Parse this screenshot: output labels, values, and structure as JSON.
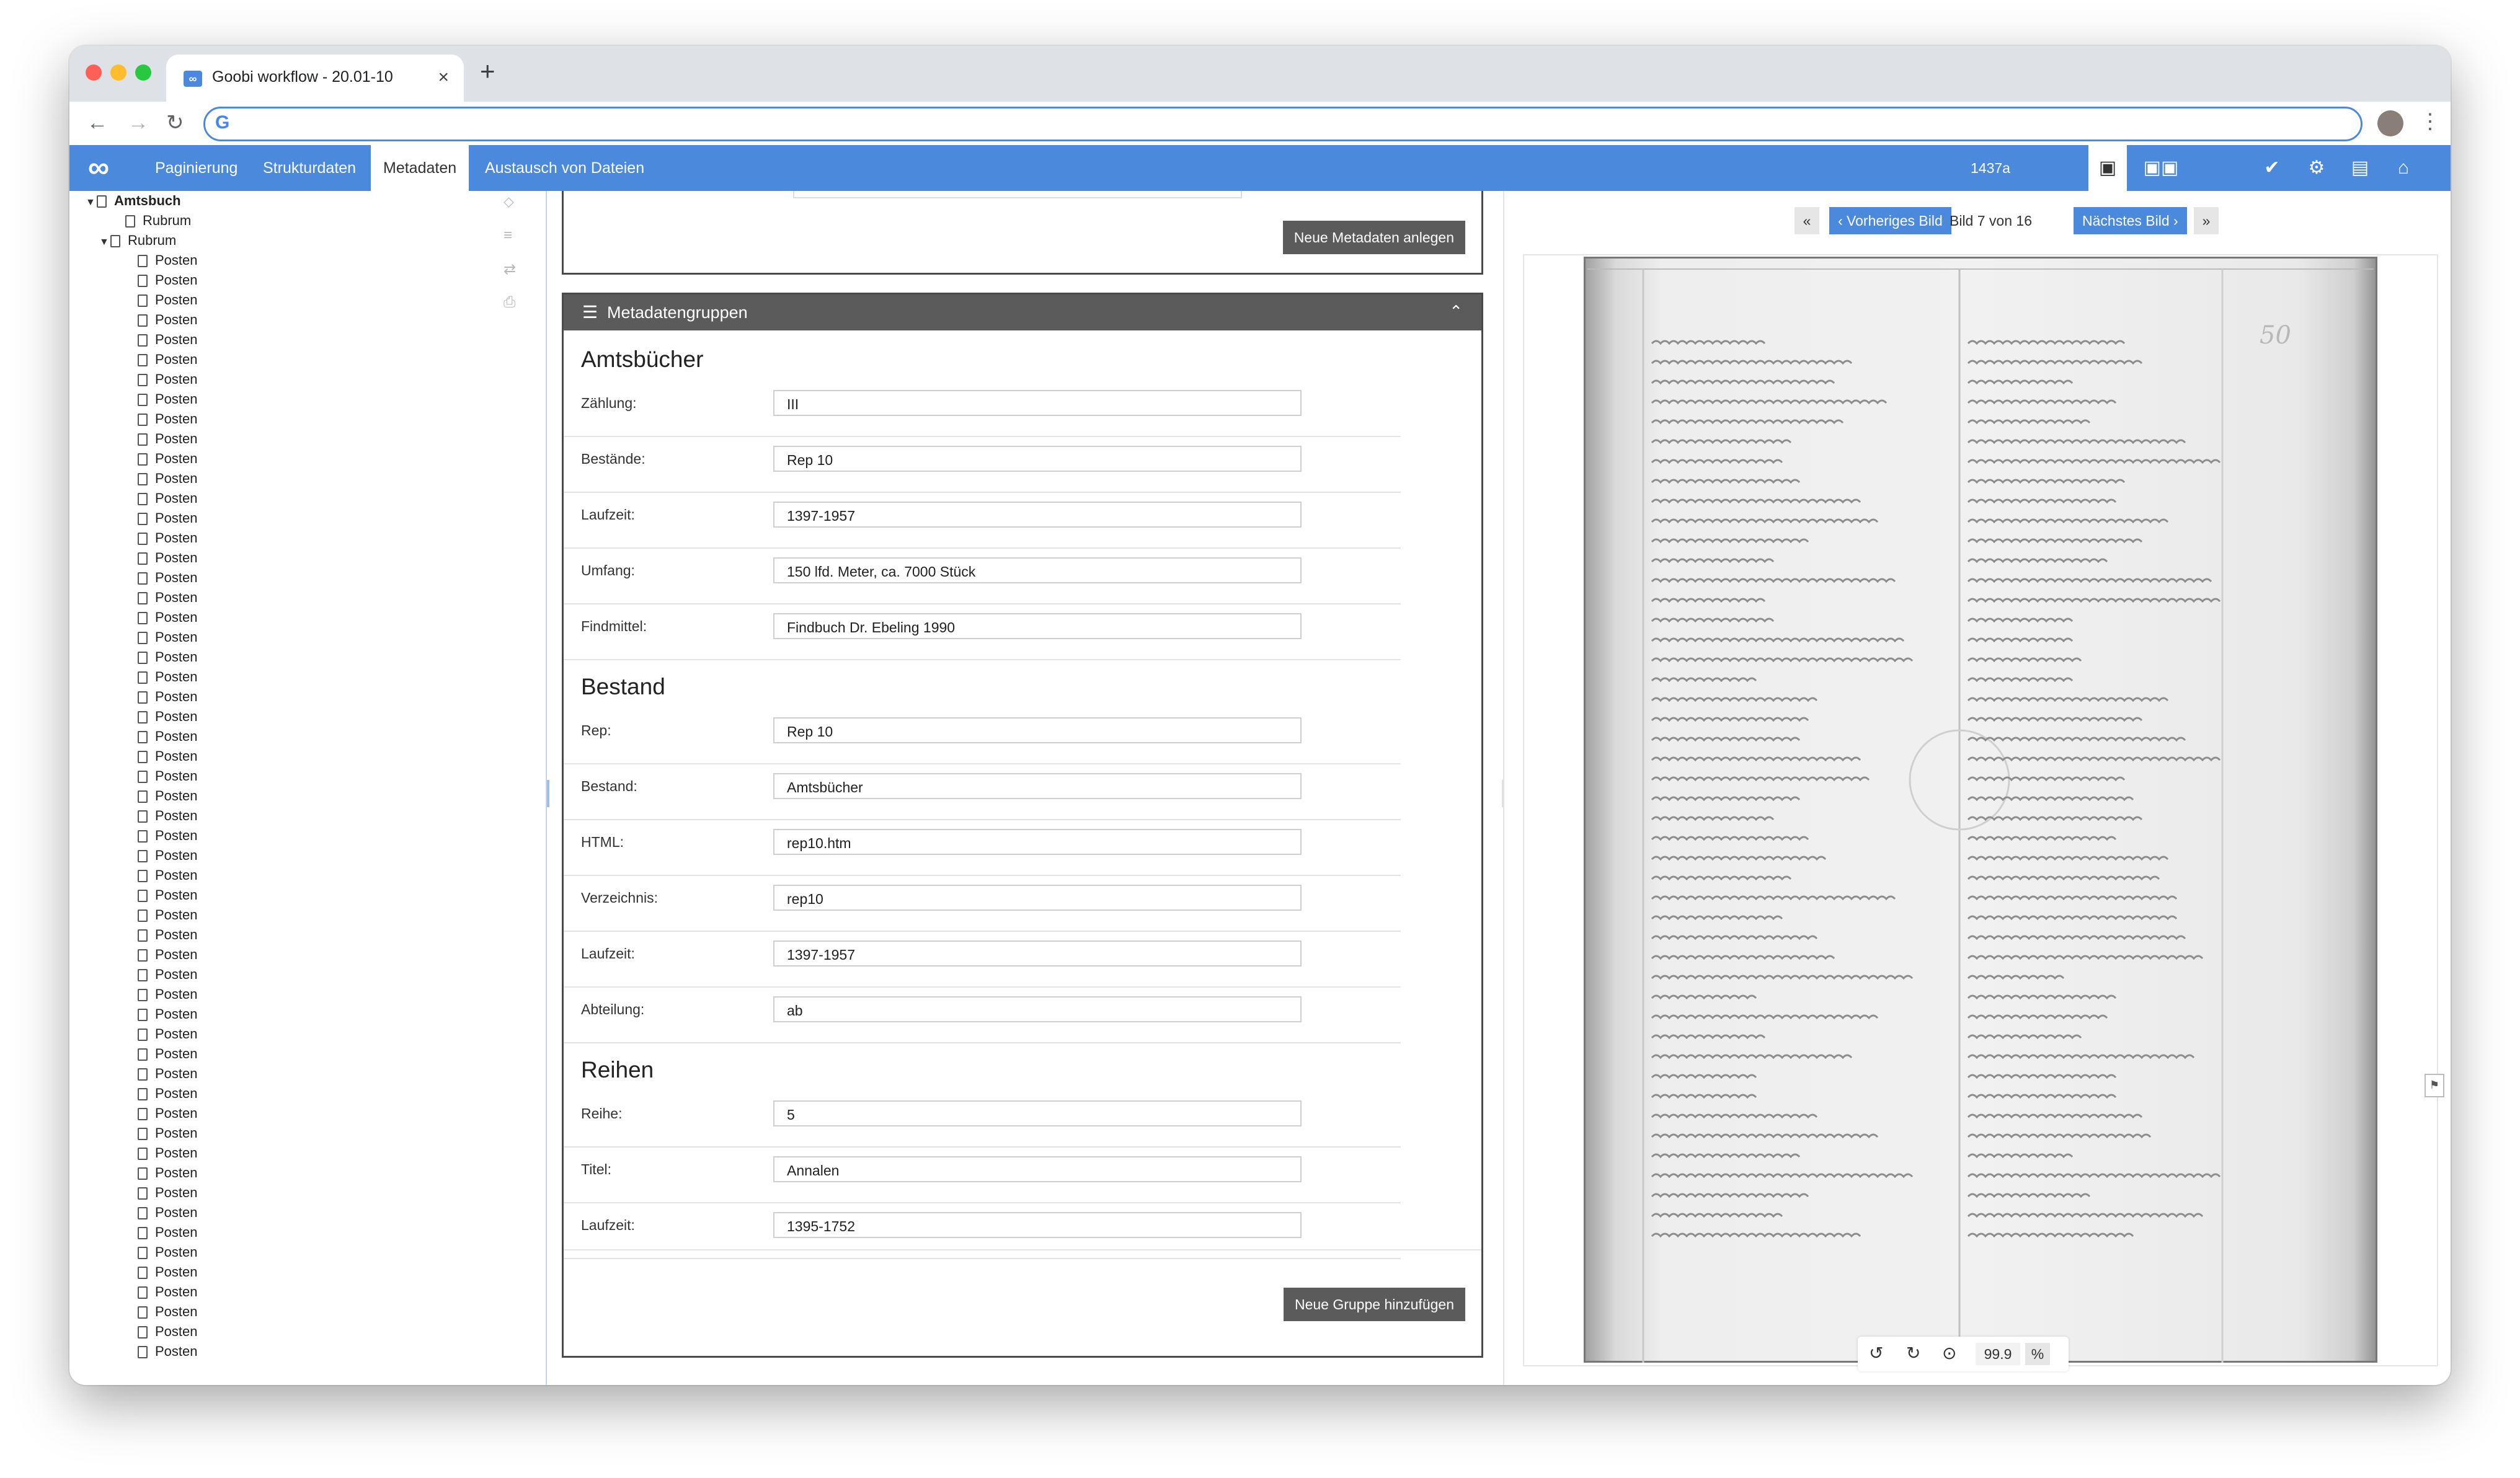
{
  "browser": {
    "tab_title": "Goobi workflow - 20.01-10",
    "tab_close": "×",
    "new_tab": "+"
  },
  "app": {
    "nav": [
      "Paginierung",
      "Strukturdaten",
      "Metadaten",
      "Austausch von Dateien"
    ],
    "active_nav": "Metadaten",
    "record_id": "1437a"
  },
  "tree": {
    "root": "Amtsbuch",
    "child1": "Rubrum",
    "child2": "Rubrum",
    "item_label": "Posten",
    "item_count": 56
  },
  "metadata": {
    "new_metadata_button": "Neue Metadaten anlegen",
    "groups_header": "Metadatengruppen",
    "sections": [
      {
        "title": "Amtsbücher",
        "rows": [
          {
            "label": "Zählung:",
            "value": "III"
          },
          {
            "label": "Bestände:",
            "value": "Rep 10"
          },
          {
            "label": "Laufzeit:",
            "value": "1397-1957"
          },
          {
            "label": "Umfang:",
            "value": "150 lfd. Meter, ca. 7000 Stück"
          },
          {
            "label": "Findmittel:",
            "value": "Findbuch Dr. Ebeling 1990"
          }
        ]
      },
      {
        "title": "Bestand",
        "rows": [
          {
            "label": "Rep:",
            "value": "Rep 10"
          },
          {
            "label": "Bestand:",
            "value": "Amtsbücher"
          },
          {
            "label": "HTML:",
            "value": "rep10.htm"
          },
          {
            "label": "Verzeichnis:",
            "value": "rep10"
          },
          {
            "label": "Laufzeit:",
            "value": "1397-1957"
          },
          {
            "label": "Abteilung:",
            "value": "ab"
          }
        ]
      },
      {
        "title": "Reihen",
        "rows": [
          {
            "label": "Reihe:",
            "value": "5"
          },
          {
            "label": "Titel:",
            "value": "Annalen"
          },
          {
            "label": "Laufzeit:",
            "value": "1395-1752"
          }
        ]
      }
    ],
    "add_group_button": "Neue Gruppe hinzufügen"
  },
  "viewer": {
    "first": "«",
    "prev_label": "‹ Vorheriges Bild",
    "page_info": "Bild 7 von 16",
    "next_label": "Nächstes Bild ›",
    "last": "»",
    "zoom_value": "99.9",
    "zoom_unit": "%"
  }
}
